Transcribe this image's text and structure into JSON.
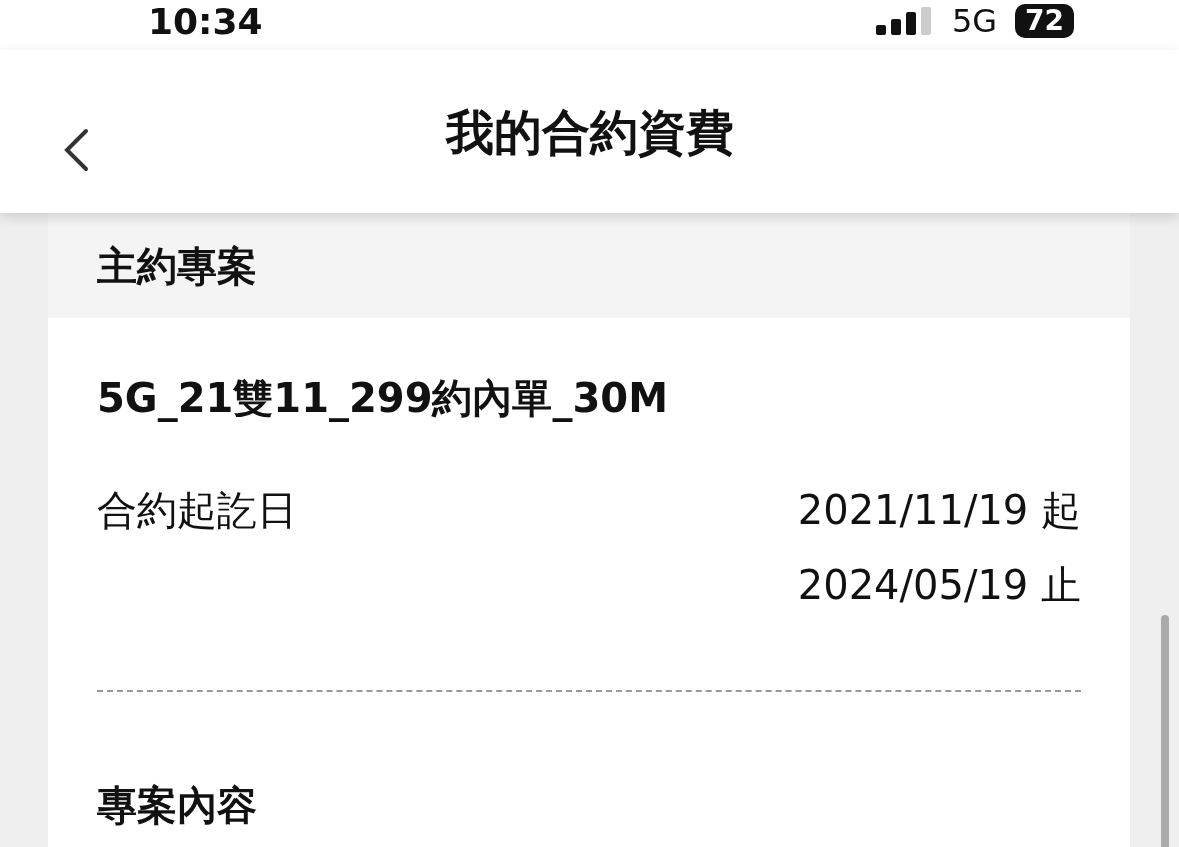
{
  "status_bar": {
    "time": "10:34",
    "network": "5G",
    "battery": "72"
  },
  "header": {
    "title": "我的合約資費"
  },
  "section": {
    "title": "主約專案",
    "plan_name": "5G_21雙11_299約內單_30M",
    "contract_period": {
      "label": "合約起訖日",
      "start": "2021/11/19 起",
      "end": "2024/05/19 止"
    }
  },
  "next_section": {
    "title": "專案內容"
  }
}
